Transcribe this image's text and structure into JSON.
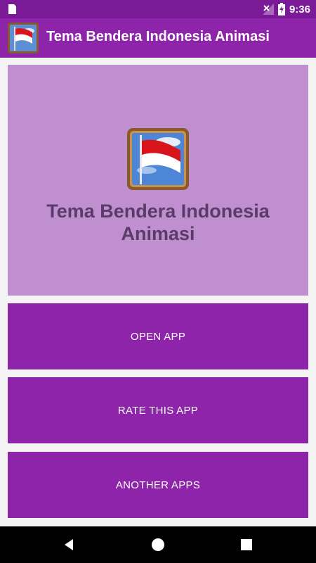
{
  "status_bar": {
    "time": "9:36"
  },
  "app_bar": {
    "title": "Tema Bendera Indonesia Animasi"
  },
  "hero": {
    "title": "Tema Bendera Indonesia Animasi"
  },
  "buttons": {
    "open": "OPEN APP",
    "rate": "RATE THIS APP",
    "another": "ANOTHER APPS"
  },
  "icons": {
    "sim": "sim-card-icon",
    "signal": "no-signal-icon",
    "battery": "battery-charging-icon",
    "app": "indonesia-flag-icon",
    "back": "back-icon",
    "home": "home-icon",
    "recents": "recents-icon"
  },
  "colors": {
    "status_bar": "#7b1a97",
    "app_bar": "#8e24aa",
    "hero_bg": "#bf8fd0",
    "button_bg": "#8e24aa",
    "hero_text": "#5b3b6a"
  }
}
